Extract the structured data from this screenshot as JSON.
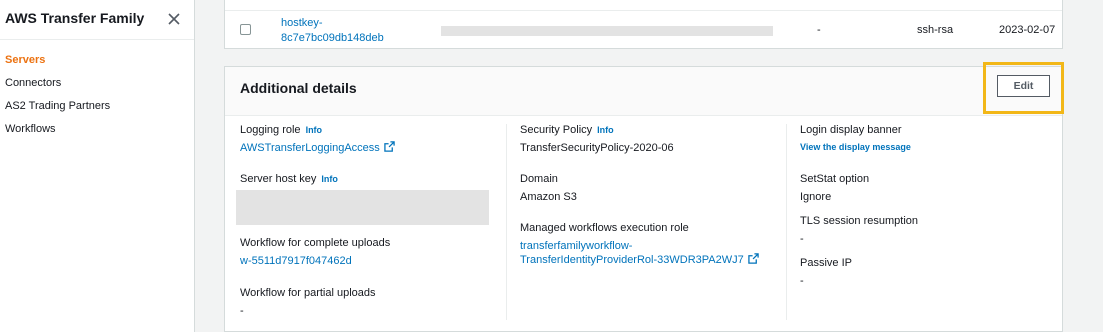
{
  "sidebar": {
    "title": "AWS Transfer Family",
    "items": [
      {
        "label": "Servers",
        "active": true
      },
      {
        "label": "Connectors",
        "active": false
      },
      {
        "label": "AS2 Trading Partners",
        "active": false
      },
      {
        "label": "Workflows",
        "active": false
      }
    ]
  },
  "host_keys_table": {
    "rows": [
      {
        "host_key_id": "hostkey-8c7e7bc09db148deb",
        "fingerprint": "",
        "description": "-",
        "type": "ssh-rsa",
        "date_imported": "2023-02-07"
      }
    ]
  },
  "additional_details": {
    "title": "Additional details",
    "edit_label": "Edit",
    "info_label": "Info",
    "logging_role": {
      "label": "Logging role",
      "value": "AWSTransferLoggingAccess"
    },
    "server_host_key": {
      "label": "Server host key"
    },
    "workflow_complete": {
      "label": "Workflow for complete uploads",
      "value": "w-5511d7917f047462d"
    },
    "workflow_partial": {
      "label": "Workflow for partial uploads",
      "value": "-"
    },
    "security_policy": {
      "label": "Security Policy",
      "value": "TransferSecurityPolicy-2020-06"
    },
    "domain": {
      "label": "Domain",
      "value": "Amazon S3"
    },
    "managed_workflows_role": {
      "label": "Managed workflows execution role",
      "value_line1": "transferfamilyworkflow-",
      "value_line2": "TransferIdentityProviderRol-33WDR3PA2WJ7"
    },
    "login_banner": {
      "label": "Login display banner",
      "value": "View the display message"
    },
    "setstat": {
      "label": "SetStat option",
      "value": "Ignore"
    },
    "tls_resumption": {
      "label": "TLS session resumption",
      "value": "-"
    },
    "passive_ip": {
      "label": "Passive IP",
      "value": "-"
    }
  },
  "colors": {
    "accent": "#ec7211",
    "link": "#0073bb",
    "highlight": "#f2b718"
  },
  "icons": {
    "close": "close-icon",
    "external": "external-link-icon"
  }
}
